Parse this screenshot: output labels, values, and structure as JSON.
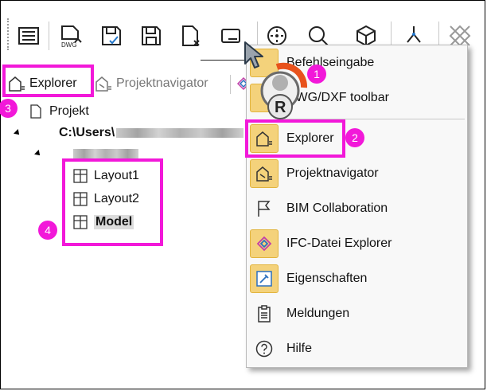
{
  "toolbar": {
    "icons": [
      "list-icon",
      "dwg-icon",
      "save-as-icon",
      "save-icon",
      "close-file-icon",
      "panel-icon",
      "navigation-icon",
      "zoom-icon",
      "cube-icon",
      "measure-icon",
      "grid-icon"
    ],
    "dwg_label": "DWG"
  },
  "tabs": {
    "explorer": "Explorer",
    "project_navigator": "Projektnavigator"
  },
  "tree": {
    "root": "Projekt",
    "path": "C:\\Users\\",
    "items": [
      "Layout1",
      "Layout2",
      "Model"
    ]
  },
  "menu": {
    "items": [
      {
        "label": "Befehlseingabe",
        "checked": true
      },
      {
        "label": "DWG/DXF toolbar",
        "checked": true
      },
      {
        "label": "Explorer",
        "checked": true
      },
      {
        "label": "Projektnavigator",
        "checked": true
      },
      {
        "label": "BIM Collaboration",
        "checked": false
      },
      {
        "label": "IFC-Datei Explorer",
        "checked": true
      },
      {
        "label": "Eigenschaften",
        "checked": true
      },
      {
        "label": "Meldungen",
        "checked": false
      },
      {
        "label": "Hilfe",
        "checked": false
      }
    ]
  },
  "badges": [
    "1",
    "2",
    "3",
    "4"
  ],
  "colors": {
    "highlight": "#f218d9",
    "checked_bg": "#f4d27b",
    "logo_orange": "#e8521c"
  }
}
